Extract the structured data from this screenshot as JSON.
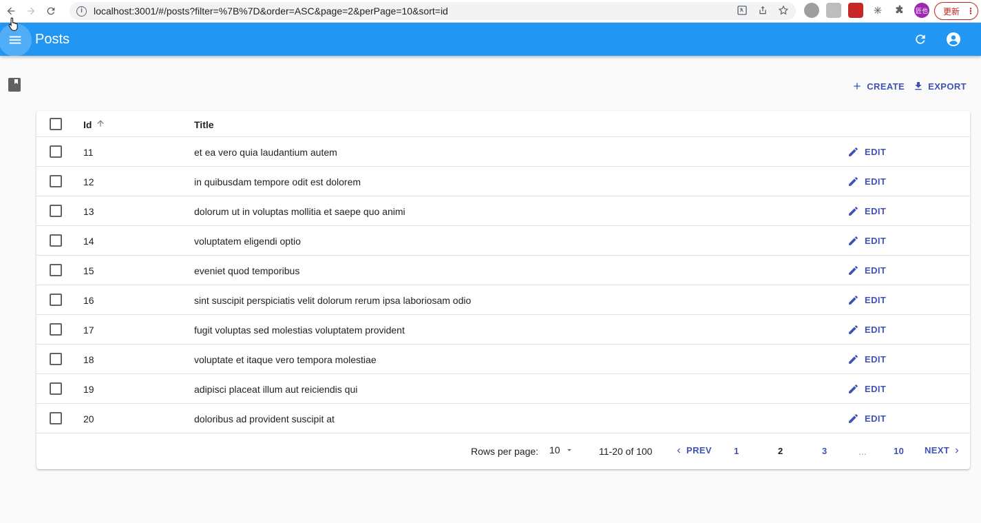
{
  "browser": {
    "url": "localhost:3001/#/posts?filter=%7B%7D&order=ASC&page=2&perPage=10&sort=id",
    "update_label": "更新",
    "profile_initials": "匠也"
  },
  "appbar": {
    "title": "Posts"
  },
  "actions": {
    "create_label": "CREATE",
    "export_label": "EXPORT"
  },
  "table": {
    "columns": {
      "id": "Id",
      "title": "Title"
    },
    "edit_label": "EDIT",
    "rows": [
      {
        "id": "11",
        "title": "et ea vero quia laudantium autem"
      },
      {
        "id": "12",
        "title": "in quibusdam tempore odit est dolorem"
      },
      {
        "id": "13",
        "title": "dolorum ut in voluptas mollitia et saepe quo animi"
      },
      {
        "id": "14",
        "title": "voluptatem eligendi optio"
      },
      {
        "id": "15",
        "title": "eveniet quod temporibus"
      },
      {
        "id": "16",
        "title": "sint suscipit perspiciatis velit dolorum rerum ipsa laboriosam odio"
      },
      {
        "id": "17",
        "title": "fugit voluptas sed molestias voluptatem provident"
      },
      {
        "id": "18",
        "title": "voluptate et itaque vero tempora molestiae"
      },
      {
        "id": "19",
        "title": "adipisci placeat illum aut reiciendis qui"
      },
      {
        "id": "20",
        "title": "doloribus ad provident suscipit at"
      }
    ]
  },
  "pagination": {
    "rows_per_page_label": "Rows per page:",
    "rows_per_page_value": "10",
    "range_label": "11-20 of 100",
    "prev_label": "PREV",
    "next_label": "NEXT",
    "page_1": "1",
    "page_2": "2",
    "page_3": "3",
    "ellipsis": "...",
    "page_last": "10"
  },
  "colors": {
    "appbar": "#2196f3",
    "primary": "#3f51b5"
  }
}
